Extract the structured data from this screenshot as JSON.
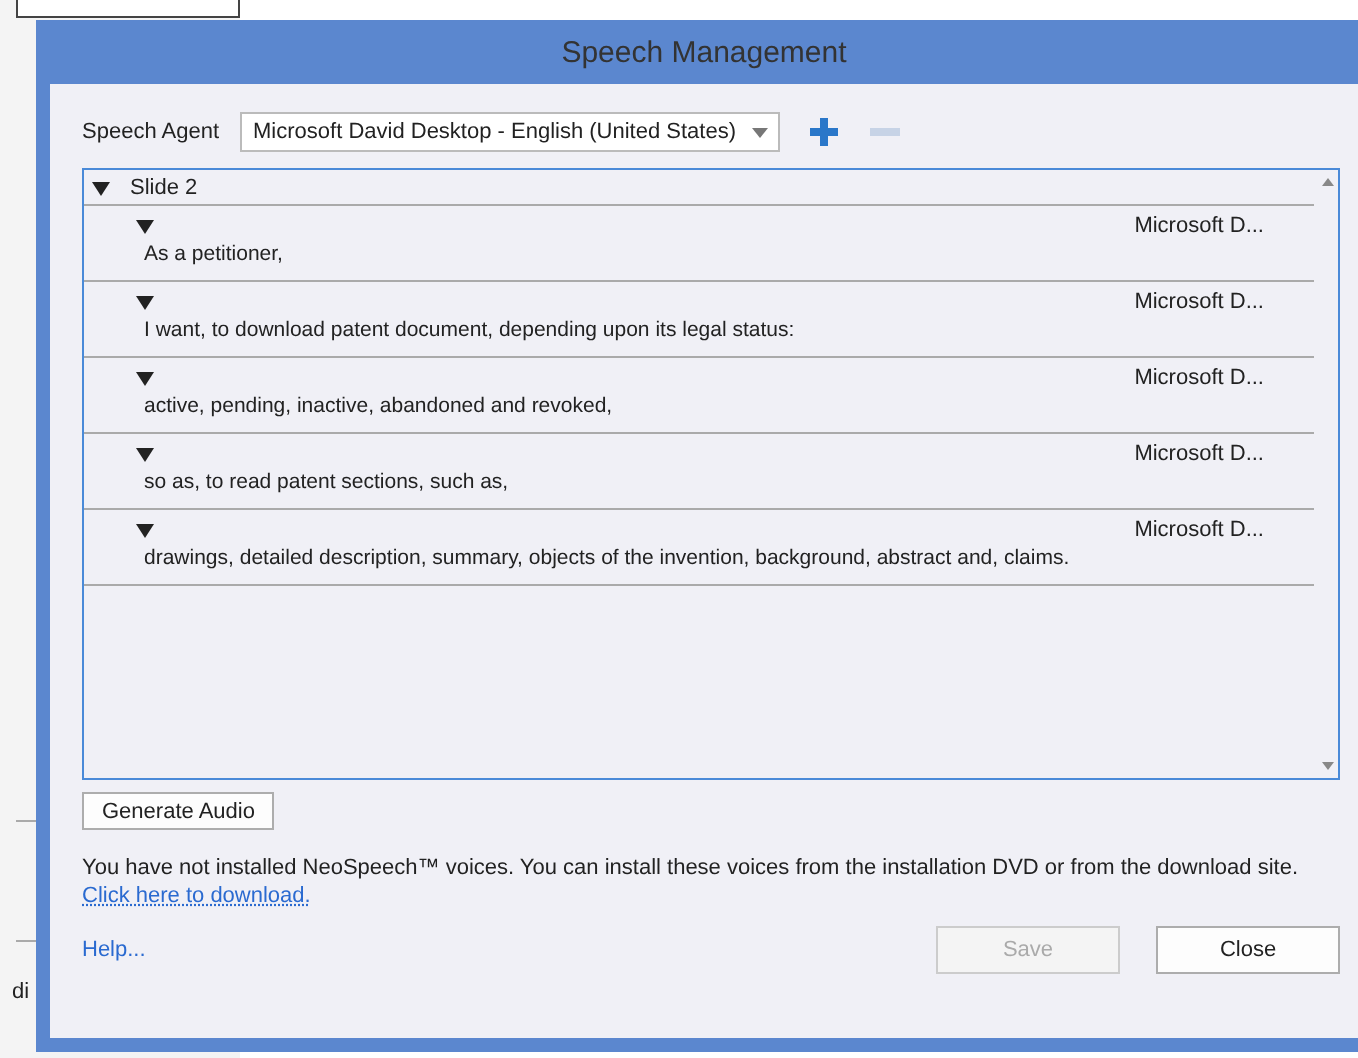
{
  "background": {
    "fragment": "di"
  },
  "window": {
    "title": "Speech Management"
  },
  "agent": {
    "label": "Speech Agent",
    "value": "Microsoft David Desktop - English (United States)"
  },
  "agent_actions": [
    {
      "kind": "add",
      "disabled": false
    },
    {
      "kind": "remove",
      "disabled": true
    }
  ],
  "tree": {
    "label": "Slide 2",
    "expanded": true,
    "children": [
      {
        "expanded": true,
        "voice": "Microsoft D...",
        "text": "As a petitioner,"
      },
      {
        "expanded": true,
        "voice": "Microsoft D...",
        "text": "I want, to download patent document, depending upon its legal status:"
      },
      {
        "expanded": true,
        "voice": "Microsoft D...",
        "text": "active, pending, inactive, abandoned and revoked,"
      },
      {
        "expanded": true,
        "voice": "Microsoft D...",
        "text": "so as, to read patent sections, such as,"
      },
      {
        "expanded": true,
        "voice": "Microsoft D...",
        "text": "drawings, detailed description, summary, objects of the invention, background, abstract and, claims."
      }
    ]
  },
  "generate_button": {
    "label": "Generate Audio"
  },
  "notice": "You have not installed NeoSpeech™ voices. You can install these voices from the installation DVD or from the download site.",
  "download_link": "Click here to download.",
  "help_link": "Help...",
  "buttons": [
    {
      "label": "Save",
      "disabled": true
    },
    {
      "label": "Close",
      "disabled": false
    }
  ]
}
